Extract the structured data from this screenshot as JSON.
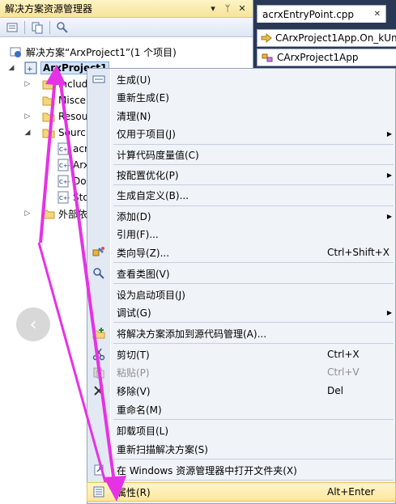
{
  "solution_explorer": {
    "title": "解决方案资源管理器",
    "pin_glyph": "▾",
    "autohide_glyph": "ᛘ",
    "close_glyph": "✕",
    "tree": [
      {
        "label": "解决方案“ArxProject1”(1 个项目)",
        "expand": ""
      },
      {
        "label": "ArxProject1",
        "expand": "◢"
      },
      {
        "label": "Includ",
        "expand": "▷"
      },
      {
        "label": "Misce",
        "expand": ""
      },
      {
        "label": "Resou",
        "expand": "▷"
      },
      {
        "label": "Sourc",
        "expand": "◢"
      },
      {
        "label": "acr",
        "expand": ""
      },
      {
        "label": "Arx",
        "expand": ""
      },
      {
        "label": "Do",
        "expand": ""
      },
      {
        "label": "Sto",
        "expand": ""
      },
      {
        "label": "外部依",
        "expand": "▷"
      }
    ]
  },
  "document": {
    "tab_label": "acrxEntryPoint.cpp",
    "tab_close": "✕",
    "nav_member": "CArxProject1App.On_kUn",
    "nav_class": "CArxProject1App"
  },
  "context_menu": {
    "items": [
      {
        "label": "生成(U)",
        "shortcut": "",
        "submenu": false,
        "disabled": false
      },
      {
        "label": "重新生成(E)",
        "shortcut": "",
        "submenu": false,
        "disabled": false
      },
      {
        "label": "清理(N)",
        "shortcut": "",
        "submenu": false,
        "disabled": false
      },
      {
        "label": "仅用于项目(J)",
        "shortcut": "",
        "submenu": true,
        "disabled": false
      },
      {
        "label": "计算代码度量值(C)",
        "shortcut": "",
        "submenu": false,
        "disabled": false
      },
      {
        "label": "按配置优化(P)",
        "shortcut": "",
        "submenu": true,
        "disabled": false
      },
      {
        "label": "生成自定义(B)...",
        "shortcut": "",
        "submenu": false,
        "disabled": false
      },
      {
        "label": "添加(D)",
        "shortcut": "",
        "submenu": true,
        "disabled": false
      },
      {
        "label": "引用(F)...",
        "shortcut": "",
        "submenu": false,
        "disabled": false
      },
      {
        "label": "类向导(Z)...",
        "shortcut": "Ctrl+Shift+X",
        "submenu": false,
        "disabled": false
      },
      {
        "label": "查看类图(V)",
        "shortcut": "",
        "submenu": false,
        "disabled": false
      },
      {
        "label": "设为启动项目(J)",
        "shortcut": "",
        "submenu": false,
        "disabled": false
      },
      {
        "label": "调试(G)",
        "shortcut": "",
        "submenu": true,
        "disabled": false
      },
      {
        "label": "将解决方案添加到源代码管理(A)...",
        "shortcut": "",
        "submenu": false,
        "disabled": false
      },
      {
        "label": "剪切(T)",
        "shortcut": "Ctrl+X",
        "submenu": false,
        "disabled": false
      },
      {
        "label": "粘贴(P)",
        "shortcut": "Ctrl+V",
        "submenu": false,
        "disabled": true
      },
      {
        "label": "移除(V)",
        "shortcut": "Del",
        "submenu": false,
        "disabled": false
      },
      {
        "label": "重命名(M)",
        "shortcut": "",
        "submenu": false,
        "disabled": false
      },
      {
        "label": "卸载项目(L)",
        "shortcut": "",
        "submenu": false,
        "disabled": false
      },
      {
        "label": "重新扫描解决方案(S)",
        "shortcut": "",
        "submenu": false,
        "disabled": false
      },
      {
        "label": "在 Windows 资源管理器中打开文件夹(X)",
        "shortcut": "",
        "submenu": false,
        "disabled": false
      },
      {
        "label": "属性(R)",
        "shortcut": "Alt+Enter",
        "submenu": false,
        "disabled": false,
        "highlighted": true
      }
    ]
  },
  "overlay": {
    "prev_glyph": "‹",
    "arrow_color": "#e632e6"
  },
  "colors": {
    "highlight": "#ffe79a",
    "selection": "#cfe3fc",
    "background": "#293955"
  }
}
